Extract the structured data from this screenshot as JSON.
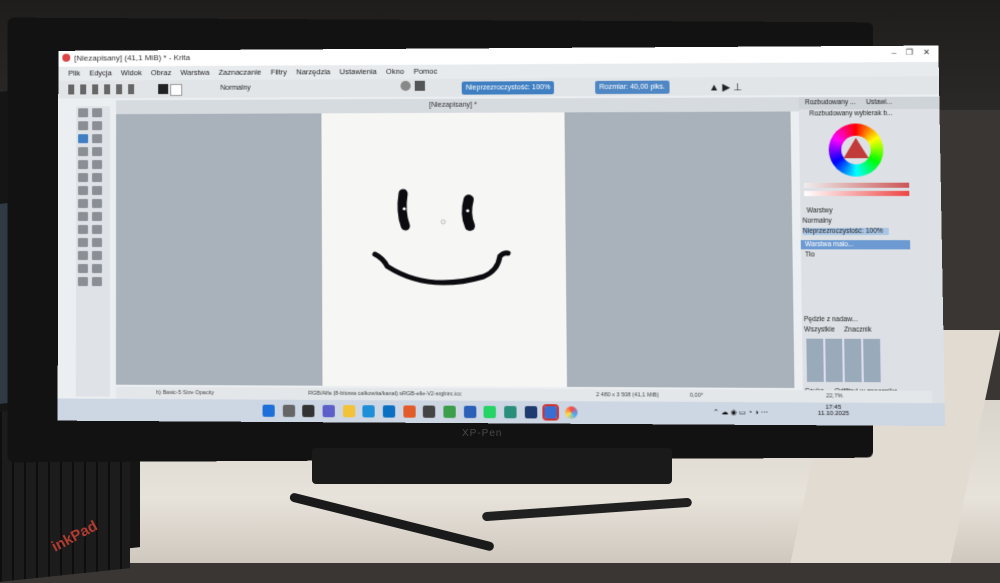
{
  "app": {
    "window_title": "[Niezapisany]  (41,1 MiB)  * - Krita",
    "menu": [
      "Plik",
      "Edycja",
      "Widok",
      "Obraz",
      "Warstwa",
      "Zaznaczanie",
      "Filtry",
      "Narzędzia",
      "Ustawienia",
      "Okno",
      "Pomoc"
    ],
    "blend_mode": "Normalny",
    "opacity_label": "Nieprzezroczystość: 100%",
    "size_label": "Rozmiar: 40,00 piks.",
    "document_tab": "[Niezapisany]  *",
    "panel_tabs": [
      "Rozbudowany ...",
      "Ustawi..."
    ],
    "color_selector_title": "Rozbudowany wybierak b...",
    "layers_title": "Warstwy",
    "layers_blend": "Normalny",
    "layers_opacity": "Nieprzezroczystość: 100%",
    "layers": [
      "Warstwa malo...",
      "Tło"
    ],
    "brush_presets_title": "Pędzle z nadaw...",
    "brush_filter": "Wszystkie",
    "brush_tag": "Znacznik",
    "brush_search": "Szuka",
    "brush_option": "Odfiltruj w znacznika",
    "status_brush": "b) Basic-5 Size Opacity",
    "status_color": "RGB/Alfa (8-bitowa całkowita/kanał)  sRGB-elle-V2-srgbtrc.icc",
    "status_size": "2 480 x 3 508 (41,1 MiB)",
    "status_rotation": "0,00°",
    "status_zoom": "22,7%"
  },
  "taskbar": {
    "time": "17:45",
    "date": "11.10.2025"
  },
  "device": {
    "monitor_brand": "XP-Pen",
    "laptop_brand": "inkPad"
  },
  "colors": {
    "accent": "#3f7fc2",
    "canvas_bg": "#a9b2ba",
    "paper": "#f6f6f4",
    "ink": "#0b0b10"
  }
}
